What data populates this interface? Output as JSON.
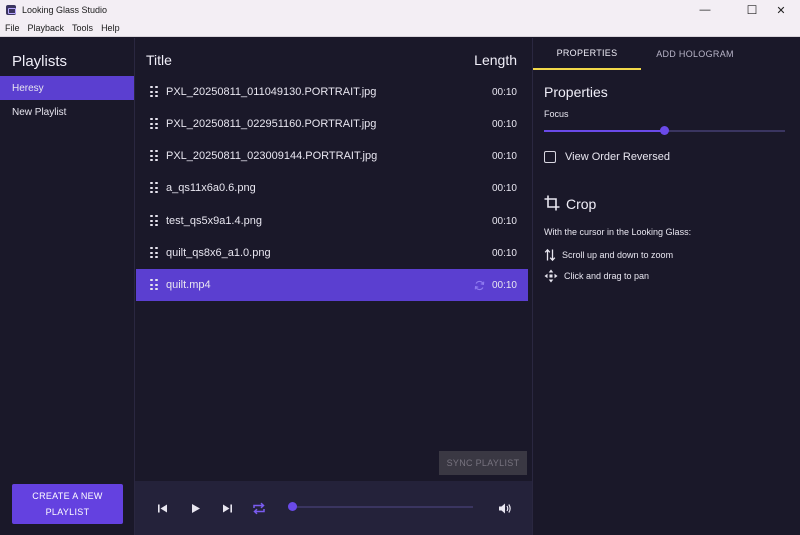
{
  "window": {
    "title": "Looking Glass Studio",
    "minimize": "—",
    "maximize": "☐",
    "close": "✕"
  },
  "menu": [
    "File",
    "Playback",
    "Tools",
    "Help"
  ],
  "sidebar": {
    "heading": "Playlists",
    "items": [
      {
        "label": "Heresy",
        "active": true
      },
      {
        "label": "New Playlist",
        "active": false
      }
    ],
    "create_button": "CREATE A NEW PLAYLIST"
  },
  "main": {
    "title_header": "Title",
    "length_header": "Length",
    "rows": [
      {
        "name": "PXL_20250811_011049130.PORTRAIT.jpg",
        "length": "00:10"
      },
      {
        "name": "PXL_20250811_022951160.PORTRAIT.jpg",
        "length": "00:10"
      },
      {
        "name": "PXL_20250811_023009144.PORTRAIT.jpg",
        "length": "00:10"
      },
      {
        "name": "a_qs11x6a0.6.png",
        "length": "00:10"
      },
      {
        "name": "test_qs5x9a1.4.png",
        "length": "00:10"
      },
      {
        "name": "quilt_qs8x6_a1.0.png",
        "length": "00:10"
      },
      {
        "name": "quilt.mp4",
        "length": "00:10",
        "active": true,
        "syncing": true
      }
    ],
    "sync_button": "SYNC PLAYLIST"
  },
  "player": {
    "icons": [
      "skip-previous-icon",
      "play-icon",
      "skip-next-icon",
      "repeat-icon",
      "volume-icon"
    ],
    "progress": 0.0
  },
  "properties": {
    "tabs": [
      {
        "label": "PROPERTIES",
        "active": true
      },
      {
        "label": "ADD HOLOGRAM",
        "active": false
      }
    ],
    "heading": "Properties",
    "focus_label": "Focus",
    "focus_value": 0.5,
    "view_order_label": "View Order Reversed",
    "view_order_checked": false,
    "crop_title": "Crop",
    "crop_desc": "With the cursor in the Looking Glass:",
    "hints": [
      {
        "icon": "zoom-arrows-icon",
        "text": "Scroll up and down to zoom"
      },
      {
        "icon": "pan-arrows-icon",
        "text": "Click and drag to pan"
      }
    ]
  },
  "colors": {
    "accent": "#6441e0",
    "active_row": "#5b3fd0",
    "tab_underline": "#f2d84a",
    "background": "#1a1829"
  }
}
